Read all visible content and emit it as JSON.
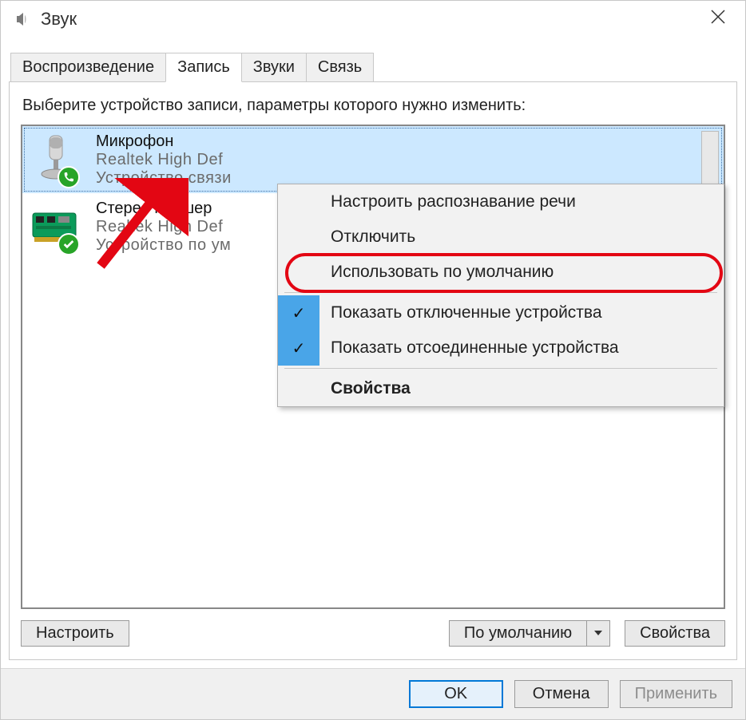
{
  "window": {
    "title": "Звук"
  },
  "tabs": [
    {
      "label": "Воспроизведение",
      "active": false
    },
    {
      "label": "Запись",
      "active": true
    },
    {
      "label": "Звуки",
      "active": false
    },
    {
      "label": "Связь",
      "active": false
    }
  ],
  "instruction": "Выберите устройство записи, параметры которого нужно изменить:",
  "devices": [
    {
      "name": "Микрофон",
      "description": "Realtek High Def",
      "status": "Устройство связи",
      "selected": true,
      "badge": "phone"
    },
    {
      "name": "Стерео микшер",
      "description": "Realtek High Def",
      "status": "Устройство по ум",
      "selected": false,
      "badge": "check"
    }
  ],
  "context_menu": [
    {
      "label": "Настроить распознавание речи",
      "checked": false
    },
    {
      "label": "Отключить",
      "checked": false
    },
    {
      "label": "Использовать по умолчанию",
      "checked": false,
      "highlighted": true
    },
    {
      "sep": true
    },
    {
      "label": "Показать отключенные устройства",
      "checked": true
    },
    {
      "label": "Показать отсоединенные устройства",
      "checked": true
    },
    {
      "sep": true
    },
    {
      "label": "Свойства",
      "checked": false,
      "bold": true
    }
  ],
  "pane_buttons": {
    "configure": "Настроить",
    "set_default": "По умолчанию",
    "properties": "Свойства"
  },
  "dialog_buttons": {
    "ok": "OK",
    "cancel": "Отмена",
    "apply": "Применить"
  }
}
